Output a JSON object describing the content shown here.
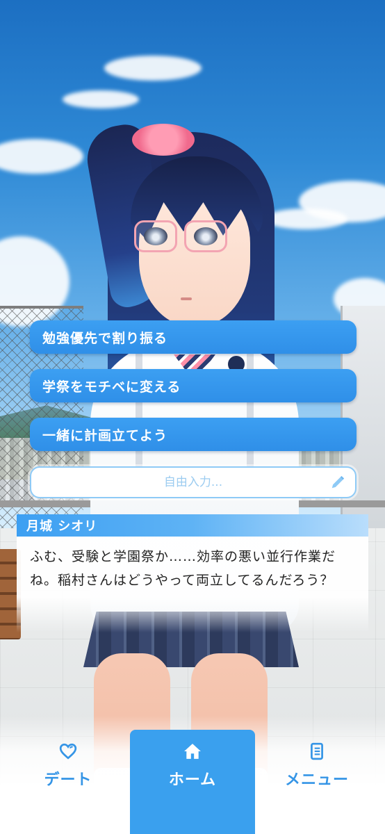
{
  "choices": [
    {
      "label": "勉強優先で割り振る"
    },
    {
      "label": "学祭をモチベに変える"
    },
    {
      "label": "一緒に計画立てよう"
    }
  ],
  "free_input": {
    "placeholder": "自由入力..."
  },
  "dialog": {
    "speaker": "月城 シオリ",
    "text_line1": "ふむ、受験と学園祭か……効率の悪い並行作業だ",
    "text_line2": "ね。稲村さんはどうやって両立してるんだろう？"
  },
  "nav": {
    "items": [
      {
        "label": "デート",
        "icon": "heart-icon"
      },
      {
        "label": "ホーム",
        "icon": "home-icon",
        "active": true
      },
      {
        "label": "メニュー",
        "icon": "menu-list-icon"
      }
    ]
  },
  "colors": {
    "accent": "#3aa0ee",
    "choice_bg": "#3c9ff2",
    "nav_text": "#3595e6"
  }
}
